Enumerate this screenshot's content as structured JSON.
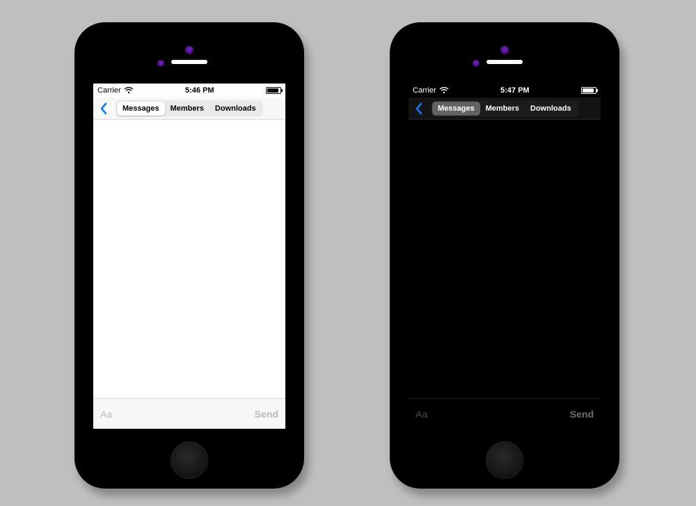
{
  "phones": {
    "light": {
      "status": {
        "carrier": "Carrier",
        "time": "5:46 PM"
      },
      "tabs": {
        "messages": "Messages",
        "members": "Members",
        "downloads": "Downloads"
      },
      "input": {
        "placeholder": "Aa",
        "send": "Send"
      }
    },
    "dark": {
      "status": {
        "carrier": "Carrier",
        "time": "5:47 PM"
      },
      "tabs": {
        "messages": "Messages",
        "members": "Members",
        "downloads": "Downloads"
      },
      "input": {
        "placeholder": "Aa",
        "send": "Send"
      }
    }
  },
  "colors": {
    "back_chevron": "#0a7aff"
  }
}
